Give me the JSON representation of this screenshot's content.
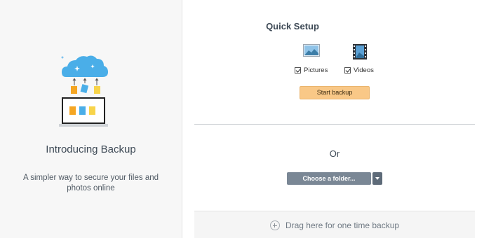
{
  "left_panel": {
    "title": "Introducing Backup",
    "description": "A simpler way to secure your files and photos online"
  },
  "quick_setup": {
    "title": "Quick Setup",
    "options": [
      {
        "label": "Pictures",
        "checked": true,
        "icon": "pictures-icon"
      },
      {
        "label": "Videos",
        "checked": true,
        "icon": "videos-icon"
      }
    ],
    "start_label": "Start backup"
  },
  "or_label": "Or",
  "choose_folder": {
    "label": "Choose a folder..."
  },
  "drop_zone": {
    "label": "Drag here for one time backup",
    "icon": "plus-circle-icon"
  },
  "colors": {
    "start_button": "#f9c887",
    "choose_button": "#7a8795",
    "cloud": "#4aaee8",
    "left_panel_bg": "#f7f7f7"
  }
}
